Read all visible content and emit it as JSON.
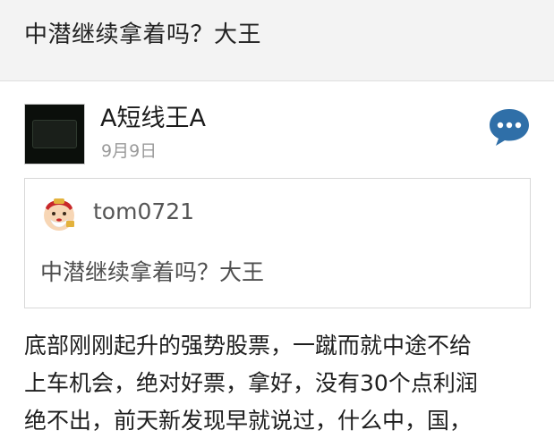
{
  "previous_post": {
    "text": "中潜继续拿着吗？大王"
  },
  "post": {
    "author": "A短线王A",
    "date": "9月9日",
    "avatar_icon": "stock-logo-avatar-icon",
    "comment_icon": "chat-bubble-icon",
    "quote": {
      "user": "tom0721",
      "user_avatar_icon": "fortune-god-avatar-icon",
      "text": "中潜继续拿着吗？大王"
    },
    "body_lines": [
      "底部刚刚起升的强势股票，一蹴而就中途不给",
      "上车机会，绝对好票，拿好，没有30个点利润",
      "绝不出，前天新发现早就说过，什么中，国，"
    ]
  },
  "colors": {
    "accent": "#2f6fa8",
    "top_background": "#f3f3f3",
    "date_gray": "#9a9a9a"
  }
}
